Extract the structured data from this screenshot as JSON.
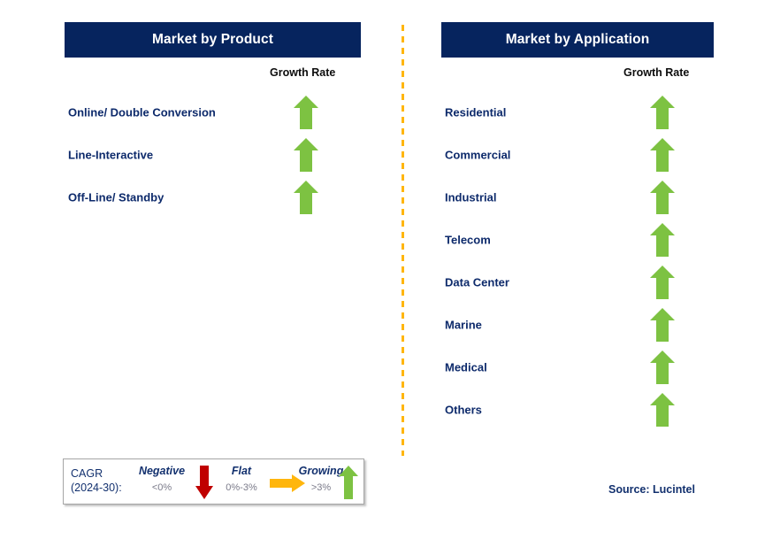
{
  "colors": {
    "header_bg": "#06245e",
    "label_navy": "#0d2a6b",
    "arrow_green": "#7dc242",
    "arrow_red": "#c00000",
    "arrow_orange": "#ffb60d",
    "divider_dashed": "#ffb60d",
    "growth_rate_text": "#0d0d0d",
    "legend_value_gray": "#7b7b8a"
  },
  "left_panel": {
    "header": "Market by Product",
    "growth_rate_label": "Growth Rate",
    "rows": [
      {
        "label": "Online/ Double Conversion",
        "trend": "growing",
        "icon": "arrow-up-icon"
      },
      {
        "label": "Line-Interactive",
        "trend": "growing",
        "icon": "arrow-up-icon"
      },
      {
        "label": "Off-Line/ Standby",
        "trend": "growing",
        "icon": "arrow-up-icon"
      }
    ]
  },
  "right_panel": {
    "header": "Market by Application",
    "growth_rate_label": "Growth Rate",
    "rows": [
      {
        "label": "Residential",
        "trend": "growing",
        "icon": "arrow-up-icon"
      },
      {
        "label": "Commercial",
        "trend": "growing",
        "icon": "arrow-up-icon"
      },
      {
        "label": "Industrial",
        "trend": "growing",
        "icon": "arrow-up-icon"
      },
      {
        "label": "Telecom",
        "trend": "growing",
        "icon": "arrow-up-icon"
      },
      {
        "label": "Data Center",
        "trend": "growing",
        "icon": "arrow-up-icon"
      },
      {
        "label": "Marine",
        "trend": "growing",
        "icon": "arrow-up-icon"
      },
      {
        "label": "Medical",
        "trend": "growing",
        "icon": "arrow-up-icon"
      },
      {
        "label": "Others",
        "trend": "growing",
        "icon": "arrow-up-icon"
      }
    ]
  },
  "legend": {
    "title_line1": "CAGR",
    "title_line2": "(2024-30):",
    "items": [
      {
        "word": "Negative",
        "value": "<0%",
        "icon": "arrow-down-icon"
      },
      {
        "word": "Flat",
        "value": "0%-3%",
        "icon": "arrow-right-icon"
      },
      {
        "word": "Growing",
        "value": ">3%",
        "icon": "arrow-up-icon"
      }
    ]
  },
  "source": "Source: Lucintel",
  "chart_data": {
    "type": "table",
    "title": "UPS Market Growth Rate by Segment",
    "legend": {
      "scale": "CAGR (2024-30)",
      "bands": [
        {
          "name": "Negative",
          "range": "<0%",
          "symbol": "red down arrow"
        },
        {
          "name": "Flat",
          "range": "0%-3%",
          "symbol": "orange right arrow"
        },
        {
          "name": "Growing",
          "range": ">3%",
          "symbol": "green up arrow"
        }
      ]
    },
    "groups": [
      {
        "name": "Market by Product",
        "value_column": "Growth Rate",
        "categories": [
          "Online/ Double Conversion",
          "Line-Interactive",
          "Off-Line/ Standby"
        ],
        "values": [
          "Growing",
          "Growing",
          "Growing"
        ]
      },
      {
        "name": "Market by Application",
        "value_column": "Growth Rate",
        "categories": [
          "Residential",
          "Commercial",
          "Industrial",
          "Telecom",
          "Data Center",
          "Marine",
          "Medical",
          "Others"
        ],
        "values": [
          "Growing",
          "Growing",
          "Growing",
          "Growing",
          "Growing",
          "Growing",
          "Growing",
          "Growing"
        ]
      }
    ],
    "source": "Source: Lucintel"
  }
}
